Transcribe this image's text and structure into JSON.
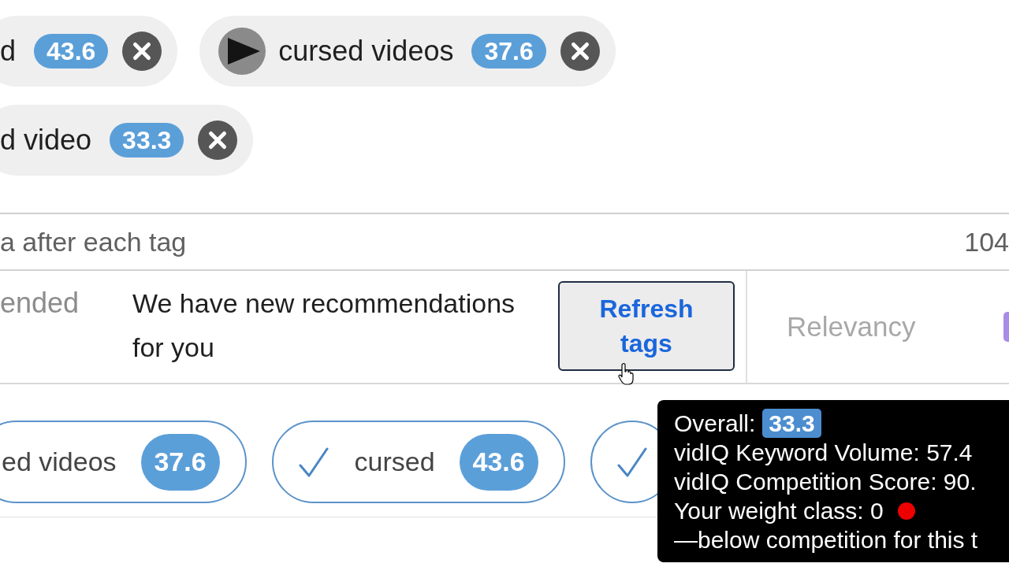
{
  "tags": [
    {
      "label": "d",
      "score": "43.6",
      "logo": false
    },
    {
      "label": "cursed videos",
      "score": "37.6",
      "logo": true
    },
    {
      "label": "d video",
      "score": "33.3",
      "logo": false
    }
  ],
  "tag_input": {
    "helper_text": "a after each tag",
    "char_count": "104"
  },
  "recommendations": {
    "title": "ended",
    "message": "We have new recommendations for you",
    "refresh_button": "Refresh tags",
    "sort_label": "Relevancy"
  },
  "recommended_tags": [
    {
      "label": "ed videos",
      "score": "37.6",
      "checked": false
    },
    {
      "label": "cursed",
      "score": "43.6",
      "checked": true
    },
    {
      "checked": true
    }
  ],
  "tooltip": {
    "lines": [
      {
        "kind": "score",
        "label": "Overall:",
        "score": "33.3"
      },
      {
        "kind": "text",
        "text": "vidIQ Keyword Volume: 57.4"
      },
      {
        "kind": "text",
        "text": "vidIQ Competition Score: 90."
      },
      {
        "kind": "dot",
        "text": "Your weight class: 0",
        "color": "#ee0000"
      },
      {
        "kind": "text",
        "text": "—below competition for this t"
      }
    ]
  }
}
